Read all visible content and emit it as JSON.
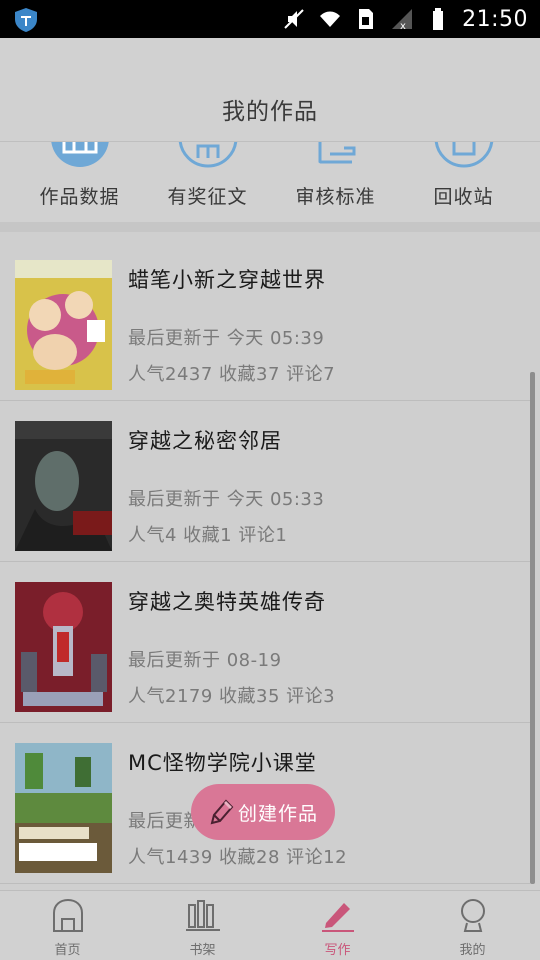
{
  "status_bar": {
    "time": "21:50",
    "icons": [
      "shield-icon",
      "mute-icon",
      "wifi-icon",
      "sim-icon",
      "signal-icon",
      "battery-icon"
    ]
  },
  "header": {
    "title": "我的作品"
  },
  "quick_actions": [
    {
      "label": "作品数据",
      "icon": "data-icon"
    },
    {
      "label": "有奖征文",
      "icon": "contest-icon"
    },
    {
      "label": "审核标准",
      "icon": "standard-icon"
    },
    {
      "label": "回收站",
      "icon": "recycle-icon"
    }
  ],
  "works": [
    {
      "title": "蜡笔小新之穿越世界",
      "updated": "最后更新于 今天 05:39",
      "stats": "人气2437 收藏37 评论7"
    },
    {
      "title": "穿越之秘密邻居",
      "updated": "最后更新于 今天 05:33",
      "stats": "人气4 收藏1 评论1"
    },
    {
      "title": "穿越之奥特英雄传奇",
      "updated": "最后更新于 08-19",
      "stats": "人气2179 收藏35 评论3"
    },
    {
      "title": "MC怪物学院小课堂",
      "updated": "最后更新于 今天 05:18",
      "stats": "人气1439 收藏28 评论12"
    }
  ],
  "create_button": {
    "label": "创建作品"
  },
  "bottom_nav": [
    {
      "label": "首页",
      "icon": "home-icon"
    },
    {
      "label": "书架",
      "icon": "bookshelf-icon"
    },
    {
      "label": "写作",
      "icon": "write-icon",
      "active": true
    },
    {
      "label": "我的",
      "icon": "profile-icon"
    }
  ],
  "colors": {
    "accent": "#c9567a",
    "create_button": "#d97796",
    "quick_icon": "#6fa8d6",
    "overlay": "#cfcfcf"
  }
}
